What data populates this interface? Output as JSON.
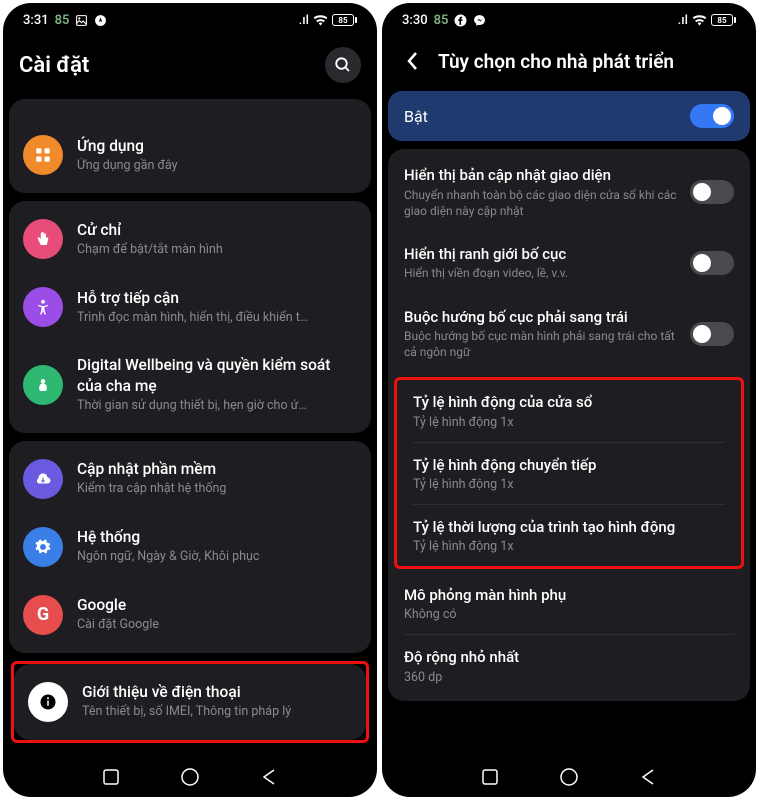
{
  "left": {
    "status": {
      "time": "3:31",
      "pct": "85",
      "battery": "85"
    },
    "title": "Cài đặt",
    "cutRow": {
      "sub": ""
    },
    "group1": [
      {
        "icon": "apps",
        "iconBg": "#f08a2b",
        "title": "Ứng dụng",
        "sub": "Ứng dụng gần đây"
      }
    ],
    "group2": [
      {
        "icon": "hand",
        "iconBg": "#e84d7a",
        "title": "Cử chỉ",
        "sub": "Chạm để bật/tắt màn hình"
      },
      {
        "icon": "access",
        "iconBg": "#9b4de8",
        "title": "Hỗ trợ tiếp cận",
        "sub": "Trình đọc màn hình, hiển thị, điều khiển t…"
      },
      {
        "icon": "wellbeing",
        "iconBg": "#2eb872",
        "title": "Digital Wellbeing và quyền kiểm soát của cha mẹ",
        "sub": "Thời gian sử dụng thiết bị, hẹn giờ cho ứ…"
      }
    ],
    "group3": [
      {
        "icon": "cloud",
        "iconBg": "#6a5ae0",
        "title": "Cập nhật phần mềm",
        "sub": "Kiểm tra cập nhật hệ thống"
      },
      {
        "icon": "gear",
        "iconBg": "#3a7ee8",
        "title": "Hệ thống",
        "sub": "Ngôn ngữ, Ngày & Giờ, Khôi phục"
      },
      {
        "icon": "google",
        "iconBg": "#e84d4d",
        "title": "Google",
        "sub": "Cài đặt Google"
      }
    ],
    "about": {
      "icon": "info",
      "iconBg": "#fff",
      "title": "Giới thiệu về điện thoại",
      "sub": "Tên thiết bị, số IMEI, Thông tin pháp lý"
    }
  },
  "right": {
    "status": {
      "time": "3:30",
      "pct": "85",
      "battery": "85"
    },
    "title": "Tùy chọn cho nhà phát triển",
    "mainToggle": {
      "label": "Bật",
      "on": true
    },
    "toggles": [
      {
        "title": "Hiển thị bản cập nhật giao diện",
        "sub": "Chuyển nhanh toàn bộ các giao diện cửa sổ khi các giao diện này cập nhật",
        "on": false
      },
      {
        "title": "Hiển thị ranh giới bố cục",
        "sub": "Hiển thị viền đoạn video, lề, v.v.",
        "on": false
      },
      {
        "title": "Buộc hướng bố cục phải sang trái",
        "sub": "Buộc hướng bố cục màn hình phải sang trái cho tất cả ngôn ngữ",
        "on": false
      }
    ],
    "scales": [
      {
        "title": "Tỷ lệ hình động của cửa sổ",
        "sub": "Tỷ lệ hình động 1x"
      },
      {
        "title": "Tỷ lệ hình động chuyển tiếp",
        "sub": "Tỷ lệ hình động 1x"
      },
      {
        "title": "Tỷ lệ thời lượng của trình tạo hình động",
        "sub": "Tỷ lệ hình động 1x"
      }
    ],
    "extras": [
      {
        "title": "Mô phỏng màn hình phụ",
        "sub": "Không có"
      },
      {
        "title": "Độ rộng nhỏ nhất",
        "sub": "360 dp"
      }
    ]
  }
}
